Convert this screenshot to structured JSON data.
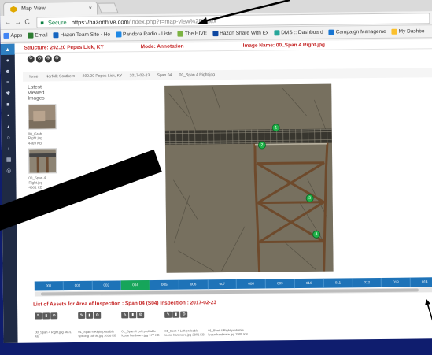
{
  "browser": {
    "tab_title": "Map View",
    "tab_close": "×",
    "secure_label": "Secure",
    "url_host": "https://hazonhive.com",
    "url_path": "/index.php?r=map-view%2Findex",
    "bookmarks": [
      {
        "label": "Apps",
        "color": "#4285f4"
      },
      {
        "label": "Email",
        "color": "#2e7d32"
      },
      {
        "label": "Hazon Team Site - Ho",
        "color": "#1565c0"
      },
      {
        "label": "Pandora Radio - Liste",
        "color": "#1e88e5"
      },
      {
        "label": "The HIVE",
        "color": "#7cb342"
      },
      {
        "label": "Hazon Share With Ex",
        "color": "#0d47a1"
      },
      {
        "label": "DMS :: Dashboard",
        "color": "#26a69a"
      },
      {
        "label": "Campaign Manageme",
        "color": "#1976d2"
      },
      {
        "label": "My Dashbo",
        "color": "#fbc02d"
      }
    ]
  },
  "app": {
    "structure": "Structure: 292.20 Pepes Lick, KY",
    "mode": "Mode: Annotation",
    "image_name": "Image Name: 00_Span 4 Right.jpg",
    "zoom_icons": [
      "↻",
      "⊖",
      "⊕",
      "⊖"
    ],
    "breadcrumb": [
      "Home",
      "Norfolk Southern",
      "292.20 Pepes Lick, KY",
      "2017-02-23",
      "Span 04",
      "00_Span 4 Right.jpg"
    ],
    "latest_title": "Latest Viewed Images",
    "latest": [
      {
        "caption": "00_Grab Right.jpg",
        "size": "4469 KB"
      },
      {
        "caption": "00_Span 4 Right.jpg",
        "size": "4601 KB"
      }
    ],
    "markers": [
      "1",
      "2",
      "3",
      "4"
    ],
    "spans": [
      "001",
      "002",
      "003",
      "004",
      "005",
      "006",
      "007",
      "008",
      "009",
      "010",
      "011",
      "012",
      "013",
      "014"
    ],
    "active_span": "004",
    "assets_title": "List of Assets for Area of Inspection : Span 04 (S04)",
    "inspection": "Inspection : 2017-02-23",
    "assets": [
      {
        "caption": "00_Span 4 Right.jpg 4601 KB"
      },
      {
        "caption": "01_Span 4 Right possible splitting rail tie.jpg 3036 KB"
      },
      {
        "caption": "01_Span 4 Left probable loose hardware.jpg 177 KB"
      },
      {
        "caption": "01_Bent 4 Left probable loose hardware.jpg 2801 KB"
      },
      {
        "caption": "01_Bent 4 Right probable loose hardware.jpg 2905 KB"
      }
    ],
    "asset_buttons": [
      "✎",
      "▮",
      "⚙"
    ]
  },
  "colors": {
    "background": "#0f1d6e",
    "header_red": "#c62828",
    "span_blue": "#1e73b8",
    "span_active": "#16a55a",
    "marker_green": "#21b34a"
  }
}
